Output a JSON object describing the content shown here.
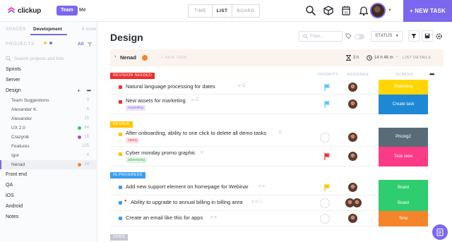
{
  "app": {
    "brand": "clickup",
    "team_label": "Team",
    "me_label": "Me",
    "view_tabs": [
      "TIME",
      "LIST",
      "BOARD"
    ],
    "new_task_label": "+ NEW TASK"
  },
  "sidebar": {
    "spaces_label": "SPACES",
    "current_space": "Development",
    "more_spaces": "6 more",
    "projects_label": "PROJECTS",
    "all_label": "All",
    "search_placeholder": "Search projects and lists",
    "items": [
      {
        "label": "Sprints"
      },
      {
        "label": "Server"
      },
      {
        "label": "Design"
      },
      {
        "label": "Team Suggestions",
        "count": "3"
      },
      {
        "label": "Alexander K.",
        "count": "6"
      },
      {
        "label": "Alexander",
        "count": "15"
      },
      {
        "label": "UX 2.0",
        "count": "44",
        "dot": "#2ecd6f"
      },
      {
        "label": "Crazynik",
        "count": "18",
        "dot": "#9b59b6"
      },
      {
        "label": "Features",
        "count": "105"
      },
      {
        "label": "Igor",
        "count": "4"
      },
      {
        "label": "Nenad",
        "count": "14",
        "dot": "#f5842b"
      },
      {
        "label": "Front end"
      },
      {
        "label": "QA"
      },
      {
        "label": "iOS"
      },
      {
        "label": "Android"
      },
      {
        "label": "Notes"
      }
    ]
  },
  "main": {
    "title": "Design",
    "filter_placeholder": "Filter...",
    "status_label": "STATUS",
    "list": {
      "name": "Nenad",
      "new_task": "+ NEW TASK",
      "time_estimate": "3 h",
      "time_tracked": "14 h 46 m",
      "details_label": "LIST DETAILS"
    },
    "columns": {
      "priority": "PRIORITY",
      "assignee": "ASSIGNEE",
      "screen": "SCREEN"
    },
    "groups": [
      {
        "label": "REVISION NEEDED",
        "color": "#f42c2c",
        "tasks": [
          {
            "name": "Natural language processing for dates",
            "dot": "#f42c2c",
            "priority": "flag-light-blue",
            "screen": "Reporting",
            "screen_color": "#ffd600"
          },
          {
            "name": "New assets for marketing",
            "dot": "#f42c2c",
            "tag": "marketing",
            "tag_bg": "#ece4fb",
            "tag_fg": "#8c6bd8",
            "priority": "flag-light-blue",
            "screen": "Create task",
            "screen_color": "#1e88d6"
          }
        ]
      },
      {
        "label": "REVIEW",
        "color": "#ffc400",
        "tasks": [
          {
            "name": "After onboarding, ability to one click to delete all demo tasks",
            "dot": "#ffc400",
            "tag": "canny",
            "tag_bg": "#fbe1e3",
            "tag_fg": "#e0455a",
            "priority": "none",
            "screen": "Pricing2",
            "screen_color": "#5a6b78"
          },
          {
            "name": "Cyber monday promo graphic",
            "dot": "#ffc400",
            "tag": "advertising",
            "tag_bg": "#e3f6e5",
            "tag_fg": "#3bb75a",
            "priority": "flag-red",
            "screen": "Task view",
            "screen_color": "#fc3b86"
          }
        ]
      },
      {
        "label": "IN PROGRESS",
        "color": "#3a9cf3",
        "tasks": [
          {
            "name": "Add new support element on homepage for Webinar",
            "dot": "#3a9cf3",
            "priority": "flag-yellow",
            "screen": "Board",
            "screen_color": "#2ecd6f"
          },
          {
            "name": "Ability to upgrade to annual billing in billing area",
            "dot": "#3a9cf3",
            "priority": "none",
            "screen": "Board",
            "screen_color": "#2ecd6f"
          },
          {
            "name": "Create an email like this for apps",
            "dot": "#3a9cf3",
            "priority": "none",
            "screen": "Time",
            "screen_color": "#f5842b"
          }
        ]
      },
      {
        "label": "OPEN",
        "color": "#c4c8ce",
        "tasks": []
      }
    ]
  }
}
